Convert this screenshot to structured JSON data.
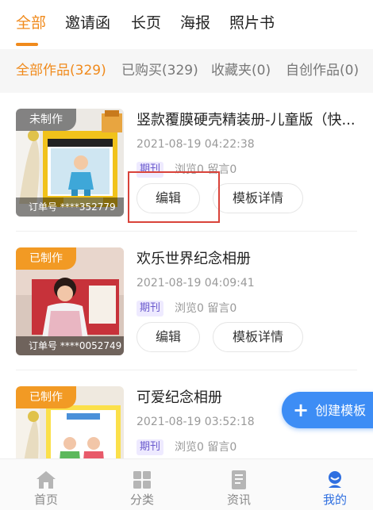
{
  "top_tabs": [
    {
      "label": "全部",
      "active": true
    },
    {
      "label": "邀请函",
      "active": false
    },
    {
      "label": "长页",
      "active": false
    },
    {
      "label": "海报",
      "active": false
    },
    {
      "label": "照片书",
      "active": false
    }
  ],
  "filters": [
    {
      "label": "全部作品(329)",
      "active": true
    },
    {
      "label": "已购买(329)",
      "active": false
    },
    {
      "label": "收藏夹(0)",
      "active": false
    },
    {
      "label": "自创作品(0)",
      "active": false
    }
  ],
  "cards": [
    {
      "status": "未制作",
      "order_text": "订单号 ****352779",
      "title": "竖款覆膜硬壳精装册-儿童版（快...",
      "time": "2021-08-19 04:22:38",
      "tag": "期刊",
      "stats": "浏览0 留言0",
      "edit_label": "编辑",
      "detail_label": "模板详情"
    },
    {
      "status": "已制作",
      "order_text": "订单号 ****0052749",
      "title": "欢乐世界纪念相册",
      "time": "2021-08-19 04:09:41",
      "tag": "期刊",
      "stats": "浏览0 留言0",
      "edit_label": "编辑",
      "detail_label": "模板详情"
    },
    {
      "status": "已制作",
      "title": "可爱纪念相册",
      "time": "2021-08-19 03:52:18",
      "tag": "期刊",
      "stats": "浏览0 留言0"
    }
  ],
  "fab": {
    "label": "创建模板"
  },
  "bottom_nav": [
    {
      "label": "首页",
      "icon": "home-icon",
      "active": false
    },
    {
      "label": "分类",
      "icon": "grid-icon",
      "active": false
    },
    {
      "label": "资讯",
      "icon": "news-icon",
      "active": false
    },
    {
      "label": "我的",
      "icon": "profile-icon",
      "active": true
    }
  ],
  "colors": {
    "accent_orange": "#f08a1c",
    "fab_blue": "#3d8df5",
    "nav_active_blue": "#2f6fe0",
    "highlight_red": "#d9433a"
  }
}
